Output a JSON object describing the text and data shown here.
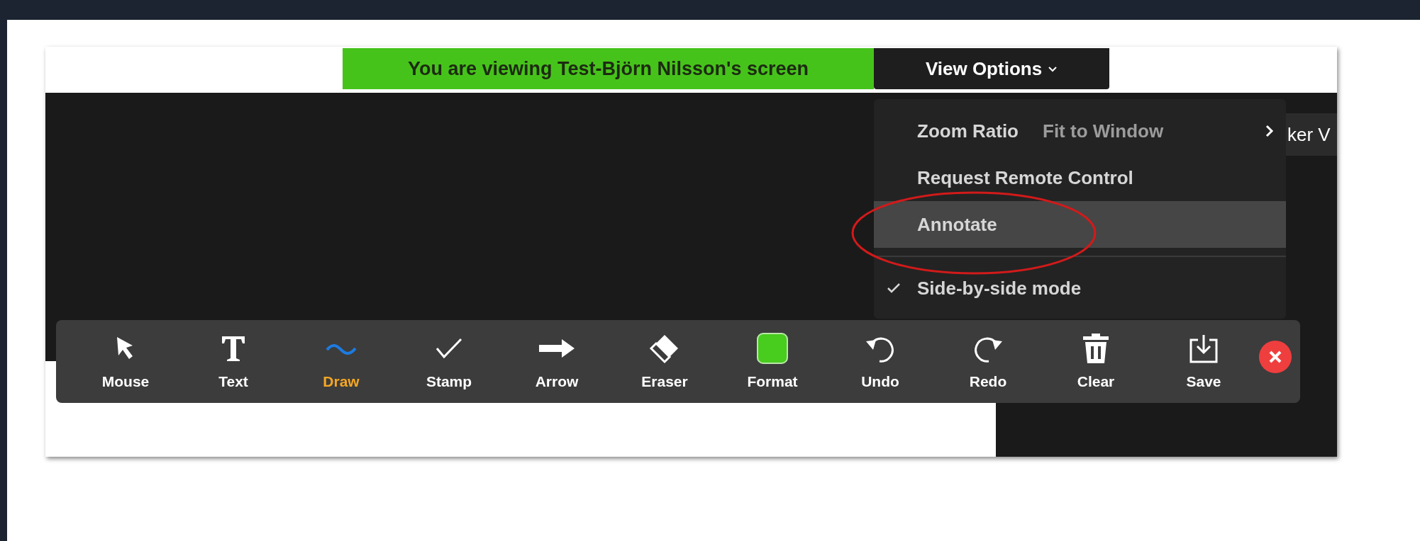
{
  "banner": {
    "text": "You are viewing Test-Björn Nilsson's screen"
  },
  "view_options": {
    "label": "View Options"
  },
  "background_bar": {
    "text": "ker V"
  },
  "menu": {
    "items": [
      {
        "kind": "submenu",
        "label": "Zoom Ratio",
        "value": "Fit to Window",
        "highlighted": false
      },
      {
        "kind": "item",
        "label": "Request Remote Control",
        "highlighted": false
      },
      {
        "kind": "item",
        "label": "Annotate",
        "highlighted": true
      },
      {
        "kind": "toggle",
        "label": "Side-by-side mode",
        "checked": true,
        "highlighted": false
      }
    ]
  },
  "toolbar": {
    "tools": [
      {
        "kind": "mouse",
        "label": "Mouse",
        "selected": false
      },
      {
        "kind": "text",
        "label": "Text",
        "selected": false
      },
      {
        "kind": "draw",
        "label": "Draw",
        "selected": true
      },
      {
        "kind": "stamp",
        "label": "Stamp",
        "selected": false
      },
      {
        "kind": "arrow",
        "label": "Arrow",
        "selected": false
      },
      {
        "kind": "eraser",
        "label": "Eraser",
        "selected": false
      },
      {
        "kind": "format",
        "label": "Format",
        "selected": false
      },
      {
        "kind": "undo",
        "label": "Undo",
        "selected": false
      },
      {
        "kind": "redo",
        "label": "Redo",
        "selected": false
      },
      {
        "kind": "clear",
        "label": "Clear",
        "selected": false
      },
      {
        "kind": "save",
        "label": "Save",
        "selected": false
      },
      {
        "kind": "close"
      }
    ]
  }
}
